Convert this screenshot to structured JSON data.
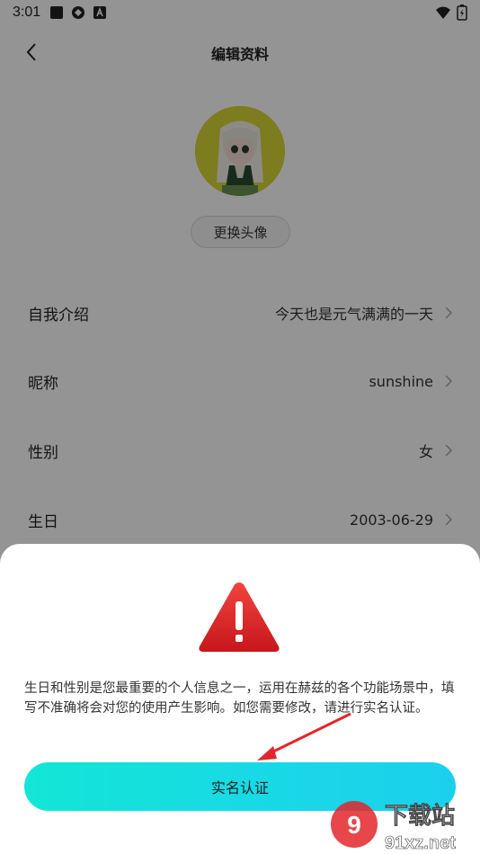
{
  "status_bar": {
    "time": "3:01"
  },
  "nav": {
    "title": "编辑资料"
  },
  "profile": {
    "change_avatar_label": "更换头像"
  },
  "rows": [
    {
      "label": "自我介绍",
      "value": "今天也是元气满满的一天"
    },
    {
      "label": "昵称",
      "value": "sunshine"
    },
    {
      "label": "性别",
      "value": "女"
    },
    {
      "label": "生日",
      "value": "2003-06-29"
    }
  ],
  "dialog": {
    "message": "生日和性别是您最重要的个人信息之一，运用在赫兹的各个功能场景中，填写不准确将会对您的使用产生影响。如您需要修改，请进行实名认证。",
    "button_label": "实名认证"
  },
  "watermark": {
    "text_cn": "下载站",
    "text_url": "91xz.net"
  },
  "colors": {
    "accent_start": "#12e6d5",
    "accent_end": "#1bd0ec",
    "warning_red": "#e3262b"
  }
}
